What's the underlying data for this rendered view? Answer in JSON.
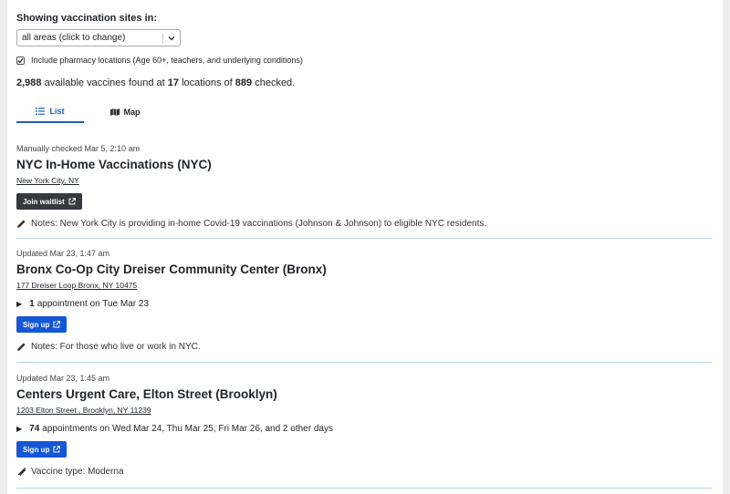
{
  "filter": {
    "label": "Showing vaccination sites in:",
    "selected": "all areas (click to change)",
    "pharmacy_checked": true,
    "pharmacy_label": "Include pharmacy locations (Age 60+, teachers, and underlying conditions)"
  },
  "summary": {
    "vaccines": "2,988",
    "text1": "available vaccines found at",
    "locations": "17",
    "text2": "locations of",
    "checked": "889",
    "text3": "checked."
  },
  "tabs": [
    {
      "label": "List",
      "active": true
    },
    {
      "label": "Map",
      "active": false
    }
  ],
  "sites": [
    {
      "meta": "Manually checked Mar 5, 2:10 am",
      "name": "NYC In-Home Vaccinations (NYC)",
      "address": "New York City, NY",
      "button": "Join waitlist",
      "note": "Notes: New York City is providing in-home Covid-19 vaccinations (Johnson & Johnson) to eligible NYC residents."
    },
    {
      "meta": "Updated Mar 23, 1:47 am",
      "name": "Bronx Co-Op City Dreiser Community Center (Bronx)",
      "address": "177 Dreiser Loop Bronx, NY 10475",
      "appt_count": "1",
      "appt_text": "appointment on Tue Mar 23",
      "button": "Sign up",
      "note": "Notes: For those who live or work in NYC."
    },
    {
      "meta": "Updated Mar 23, 1:45 am",
      "name": "Centers Urgent Care, Elton Street (Brooklyn)",
      "address": "1203 Elton Street , Brooklyn, NY 11239",
      "appt_count": "74",
      "appt_text": "appointments on Wed Mar 24, Thu Mar 25, Fri Mar 26, and 2 other days",
      "button": "Sign up",
      "note": "Vaccine type: Moderna"
    }
  ],
  "colors": {
    "accent": "#1a5fb4",
    "signup": "#1657d6",
    "waitlist": "#343a40",
    "divider": "#b9d1ea"
  }
}
